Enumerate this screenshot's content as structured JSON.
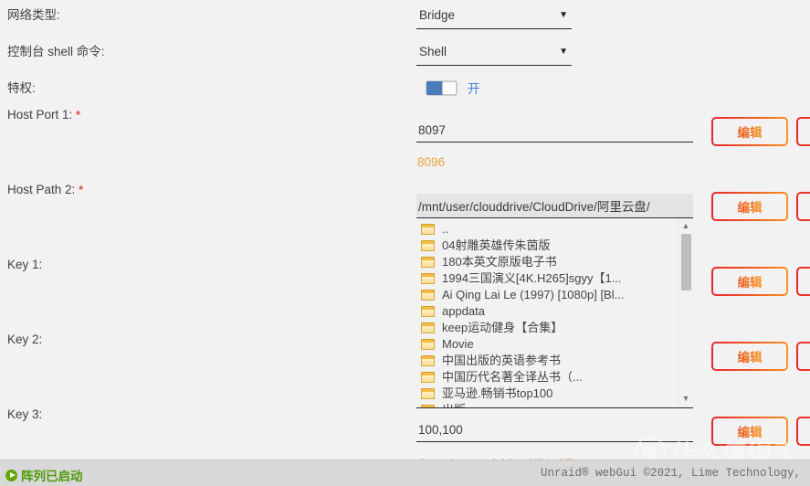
{
  "form": {
    "labels": [
      {
        "text": "网络类型:",
        "required": false
      },
      {
        "text": "控制台 shell 命令:",
        "required": false
      },
      {
        "text": "特权:",
        "required": false
      },
      {
        "text": "Host Port 1:",
        "required": true
      },
      {
        "text": "Host Path 2:",
        "required": true
      },
      {
        "text": "Key 1:",
        "required": false
      },
      {
        "text": "Key 2:",
        "required": false
      },
      {
        "text": "Key 3:",
        "required": false
      }
    ],
    "network_type": {
      "value": "Bridge",
      "caret": "chevron-down-icon"
    },
    "console_shell": {
      "value": "Shell",
      "caret": "chevron-down-icon"
    },
    "privileged": {
      "state": "on",
      "label": "开"
    },
    "host_port_1": {
      "value": "8097",
      "hint": "8096"
    },
    "host_path_2": {
      "value": "/mnt/user/clouddrive/CloudDrive/阿里云盘/",
      "placeholder": ""
    },
    "key_3": {
      "value": "100,100",
      "hint": "Container Variable: CIDLIST"
    },
    "edit_button_label": "编辑"
  },
  "filebrowser": {
    "entries": [
      "..",
      "04射雕英雄传朱茵版",
      "180本英文原版电子书",
      "1994三国演义[4K.H265]sgyy【1...",
      "Ai Qing Lai Le (1997) [1080p] [Bl...",
      "appdata",
      "keep运动健身【合集】",
      "Movie",
      "中国出版的英语参考书",
      "中国历代名著全译丛书（...",
      "亚马逊.畅销书top100",
      "出版"
    ],
    "scroll_up": "▲",
    "scroll_down": "▼"
  },
  "footer": {
    "array_status": "阵列已启动",
    "copyright": "Unraid® webGui ©2021, Lime Technology,"
  },
  "watermark": {
    "badge": "值",
    "text": "什么值得买"
  },
  "colors": {
    "accent_orange": "#e8a33d",
    "button_gradient_start": "#e8282c",
    "button_gradient_end": "#f79421",
    "toggle_on": "#4a7ebb",
    "status_green": "#4e9a06",
    "required_red": "#d9534f"
  }
}
